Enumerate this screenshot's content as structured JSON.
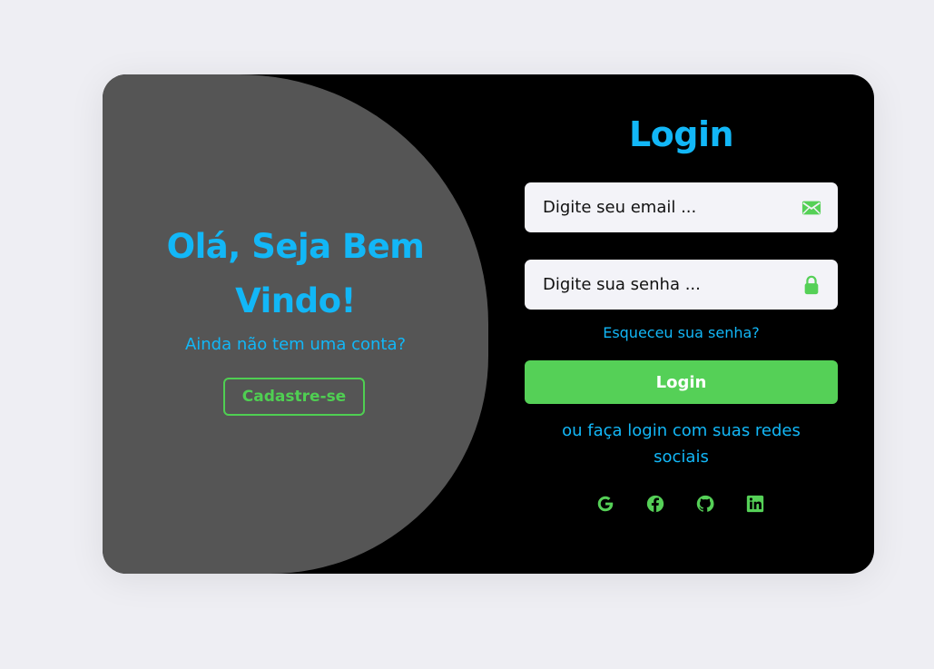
{
  "welcome": {
    "title_line1": "Olá, Seja Bem",
    "title_line2": "Vindo!",
    "subtitle": "Ainda não tem uma conta?",
    "signup_label": "Cadastre-se"
  },
  "login": {
    "title": "Login",
    "email_placeholder": "Digite seu email ...",
    "password_placeholder": "Digite sua senha ...",
    "forgot_label": "Esqueceu sua senha?",
    "button_label": "Login",
    "social_text": "ou faça login com suas redes sociais"
  },
  "icons": {
    "email": "envelope-icon",
    "password": "lock-icon",
    "social": [
      "google-icon",
      "facebook-icon",
      "github-icon",
      "linkedin-icon"
    ]
  },
  "colors": {
    "accent_blue": "#12b7f7",
    "accent_green": "#55d057",
    "panel_gray": "#555555",
    "card_black": "#000000",
    "page_bg": "#eeeef3"
  }
}
